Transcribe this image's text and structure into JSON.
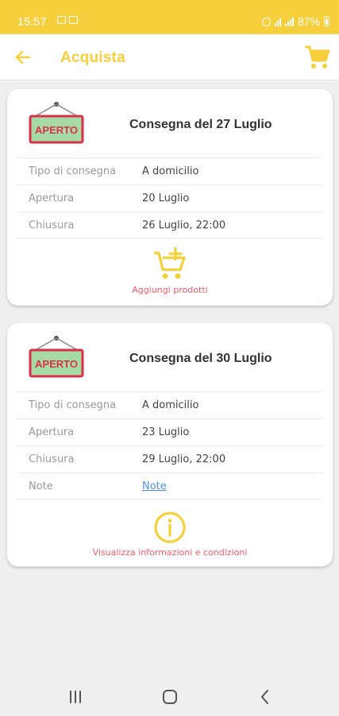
{
  "status": {
    "time": "15:57",
    "battery": "87%"
  },
  "app_bar": {
    "title": "Acquista"
  },
  "deliveries": [
    {
      "sign_label": "APERTO",
      "title": "Consegna del 27 Luglio",
      "rows": [
        {
          "label": "Tipo di consegna",
          "value": "A domicilio"
        },
        {
          "label": "Apertura",
          "value": "20 Luglio"
        },
        {
          "label": "Chiusura",
          "value": "26 Luglio, 22:00"
        }
      ],
      "action_label": "Aggiungi prodotti"
    },
    {
      "sign_label": "APERTO",
      "title": "Consegna del 30 Luglio",
      "rows": [
        {
          "label": "Tipo di consegna",
          "value": "A domicilio"
        },
        {
          "label": "Apertura",
          "value": "23 Luglio"
        },
        {
          "label": "Chiusura",
          "value": "29 Luglio, 22:00"
        },
        {
          "label": "Note",
          "value": "Note"
        }
      ],
      "action_label": "Visualizza informazioni e condizioni"
    }
  ],
  "colors": {
    "accent": "#f5cf3c",
    "action_text": "#f05d6a",
    "sign_red": "#d8314a",
    "sign_green": "#a6dba6",
    "link": "#4a90e2"
  },
  "icons": [
    "back-arrow-icon",
    "cart-icon",
    "open-sign-icon",
    "add-to-cart-icon",
    "info-icon",
    "recent-apps-icon",
    "home-icon",
    "nav-back-icon"
  ]
}
